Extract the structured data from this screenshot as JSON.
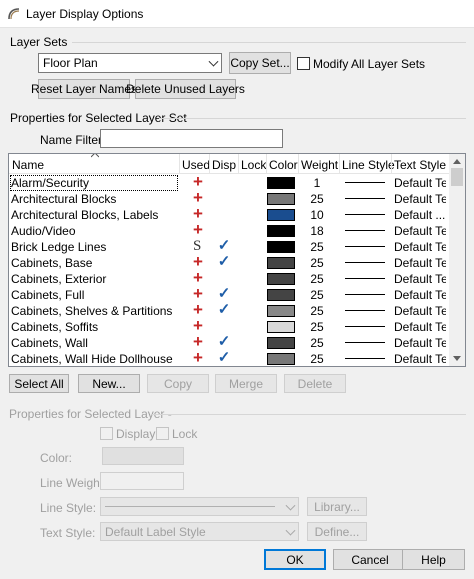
{
  "window": {
    "title": "Layer Display Options"
  },
  "layer_sets": {
    "group_label": "Layer Sets",
    "selected": "Floor Plan",
    "copy_set": "Copy Set...",
    "modify_all_label": "Modify All Layer Sets",
    "modify_all_checked": false,
    "reset_names": "Reset Layer Names",
    "delete_unused": "Delete Unused Layers"
  },
  "properties_set": {
    "group_label": "Properties for Selected Layer Set",
    "name_filter_label": "Name Filter:",
    "name_filter_value": ""
  },
  "grid": {
    "columns": [
      "Name",
      "Used",
      "Disp",
      "Lock",
      "Color",
      "Weight",
      "Line Style",
      "Text Style"
    ],
    "rows": [
      {
        "name": "Alarm/Security",
        "used": "plus",
        "disp": false,
        "color": "#000000",
        "weight": "1",
        "text_style": "Default Te..."
      },
      {
        "name": "Architectural Blocks",
        "used": "plus",
        "disp": false,
        "color": "#777777",
        "weight": "25",
        "text_style": "Default Te..."
      },
      {
        "name": "Architectural Blocks, Labels",
        "used": "plus",
        "disp": false,
        "color": "#1a4d8f",
        "weight": "10",
        "text_style": "Default ..."
      },
      {
        "name": "Audio/Video",
        "used": "plus",
        "disp": false,
        "color": "#000000",
        "weight": "18",
        "text_style": "Default Te..."
      },
      {
        "name": "Brick Ledge Lines",
        "used": "S",
        "disp": true,
        "color": "#000000",
        "weight": "25",
        "text_style": "Default Te..."
      },
      {
        "name": "Cabinets,  Base",
        "used": "plus",
        "disp": true,
        "color": "#444444",
        "weight": "25",
        "text_style": "Default Te..."
      },
      {
        "name": "Cabinets,  Exterior",
        "used": "plus",
        "disp": false,
        "color": "#444444",
        "weight": "25",
        "text_style": "Default Te..."
      },
      {
        "name": "Cabinets,  Full",
        "used": "plus",
        "disp": true,
        "color": "#444444",
        "weight": "25",
        "text_style": "Default Te..."
      },
      {
        "name": "Cabinets,  Shelves & Partitions",
        "used": "plus",
        "disp": true,
        "color": "#888888",
        "weight": "25",
        "text_style": "Default Te..."
      },
      {
        "name": "Cabinets,  Soffits",
        "used": "plus",
        "disp": false,
        "color": "#d8d8d8",
        "weight": "25",
        "text_style": "Default Te..."
      },
      {
        "name": "Cabinets,  Wall",
        "used": "plus",
        "disp": true,
        "color": "#444444",
        "weight": "25",
        "text_style": "Default Te..."
      },
      {
        "name": "Cabinets,  Wall Hide Dollhouse",
        "used": "plus",
        "disp": true,
        "color": "#777777",
        "weight": "25",
        "text_style": "Default Te..."
      }
    ]
  },
  "grid_buttons": {
    "select_all": "Select All",
    "new": "New...",
    "copy": "Copy",
    "merge": "Merge",
    "delete": "Delete"
  },
  "properties_layer": {
    "group_label": "Properties for Selected Layer -",
    "display_label": "Display",
    "lock_label": "Lock",
    "color_label": "Color:",
    "line_weight_label": "Line Weight:",
    "line_style_label": "Line Style:",
    "library_button": "Library...",
    "text_style_label": "Text Style:",
    "text_style_value": "Default Label Style",
    "define_button": "Define..."
  },
  "footer": {
    "ok": "OK",
    "cancel": "Cancel",
    "help": "Help"
  }
}
